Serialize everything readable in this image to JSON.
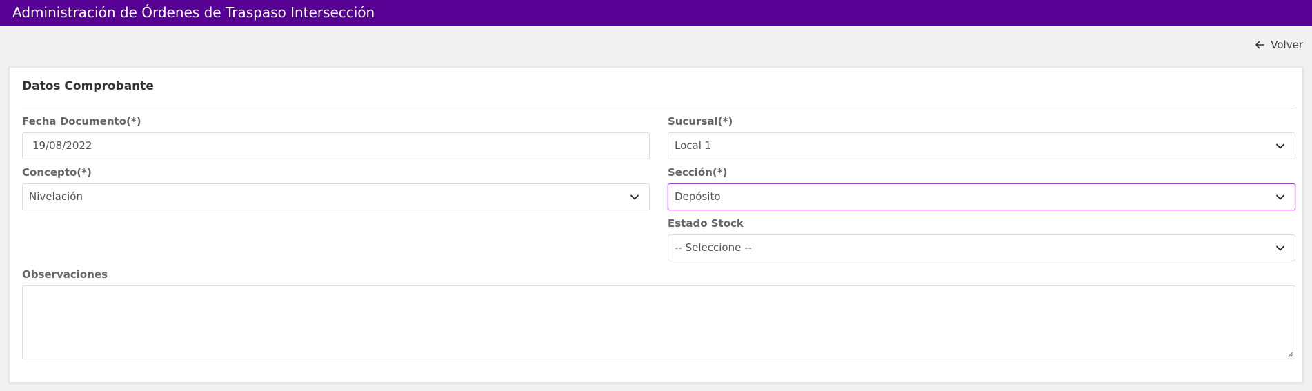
{
  "header": {
    "title": "Administración de Órdenes de Traspaso Intersección"
  },
  "nav": {
    "back_label": "Volver"
  },
  "card": {
    "title": "Datos Comprobante"
  },
  "form": {
    "fecha": {
      "label": "Fecha Documento(*)",
      "value": "19/08/2022"
    },
    "sucursal": {
      "label": "Sucursal(*)",
      "value": "Local 1"
    },
    "concepto": {
      "label": "Concepto(*)",
      "value": "Nivelación"
    },
    "seccion": {
      "label": "Sección(*)",
      "value": "Depósito"
    },
    "estado_stock": {
      "label": "Estado Stock",
      "value": "-- Seleccione --"
    },
    "observaciones": {
      "label": "Observaciones",
      "value": ""
    }
  },
  "colors": {
    "header_bg": "#560094",
    "focus_border": "#a040c8"
  },
  "icons": {
    "back": "arrow-left-icon",
    "select": "chevron-down-icon"
  }
}
